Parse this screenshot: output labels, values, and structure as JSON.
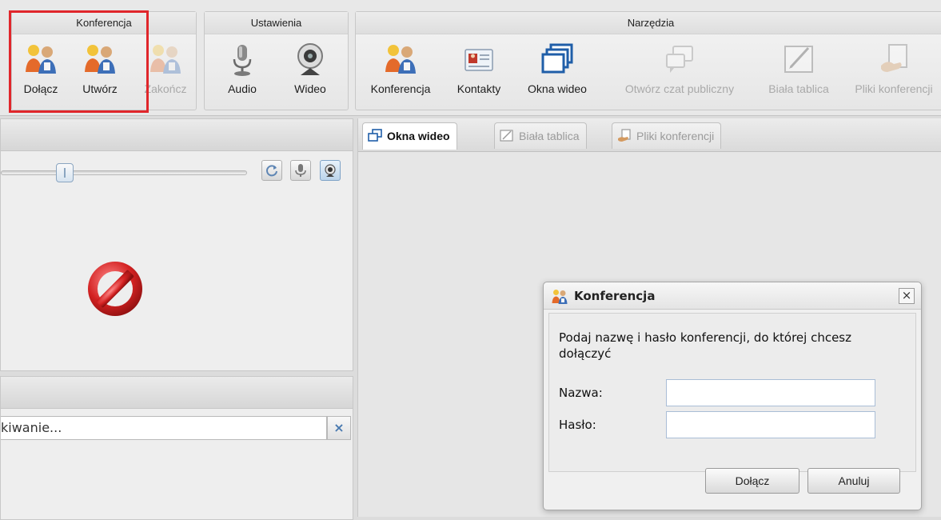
{
  "toolbar": {
    "groups": [
      {
        "title": "Konferencja",
        "tools": [
          {
            "label": "Dołącz",
            "icon": "users-join-icon",
            "enabled": true
          },
          {
            "label": "Utwórz",
            "icon": "users-create-icon",
            "enabled": true
          },
          {
            "label": "Zakończ",
            "icon": "users-end-icon",
            "enabled": false
          }
        ]
      },
      {
        "title": "Ustawienia",
        "tools": [
          {
            "label": "Audio",
            "icon": "microphone-icon",
            "enabled": true
          },
          {
            "label": "Wideo",
            "icon": "webcam-icon",
            "enabled": true
          }
        ]
      },
      {
        "title": "Narzędzia",
        "tools": [
          {
            "label": "Konferencja",
            "icon": "users-conference-icon",
            "enabled": true
          },
          {
            "label": "Kontakty",
            "icon": "contact-card-icon",
            "enabled": true
          },
          {
            "label": "Okna wideo",
            "icon": "video-windows-icon",
            "enabled": true
          },
          {
            "label": "Otwórz czat publiczny",
            "icon": "chat-bubbles-icon",
            "enabled": false
          },
          {
            "label": "Biała tablica",
            "icon": "whiteboard-icon",
            "enabled": false
          },
          {
            "label": "Pliki konferencji",
            "icon": "conference-files-icon",
            "enabled": false
          }
        ]
      }
    ],
    "highlight_color": "#e0262b"
  },
  "left_panel": {
    "slider_value": 0.25,
    "buttons": [
      "refresh-icon",
      "microphone-small-icon",
      "webcam-small-icon"
    ],
    "status_icon": "forbidden-icon",
    "search": {
      "value": "kiwanie...",
      "clear_label": "×"
    }
  },
  "tabs": [
    {
      "label": "Okna wideo",
      "active": true,
      "icon": "video-windows-icon"
    },
    {
      "label": "Biała tablica",
      "active": false,
      "icon": "whiteboard-icon"
    },
    {
      "label": "Pliki konferencji",
      "active": false,
      "icon": "conference-files-icon"
    }
  ],
  "dialog": {
    "title": "Konferencja",
    "message": "Podaj nazwę i hasło konferencji, do której chcesz dołączyć",
    "name_label": "Nazwa:",
    "name_value": "",
    "password_label": "Hasło:",
    "password_value": "",
    "join_label": "Dołącz",
    "cancel_label": "Anuluj",
    "close_label": "×"
  }
}
